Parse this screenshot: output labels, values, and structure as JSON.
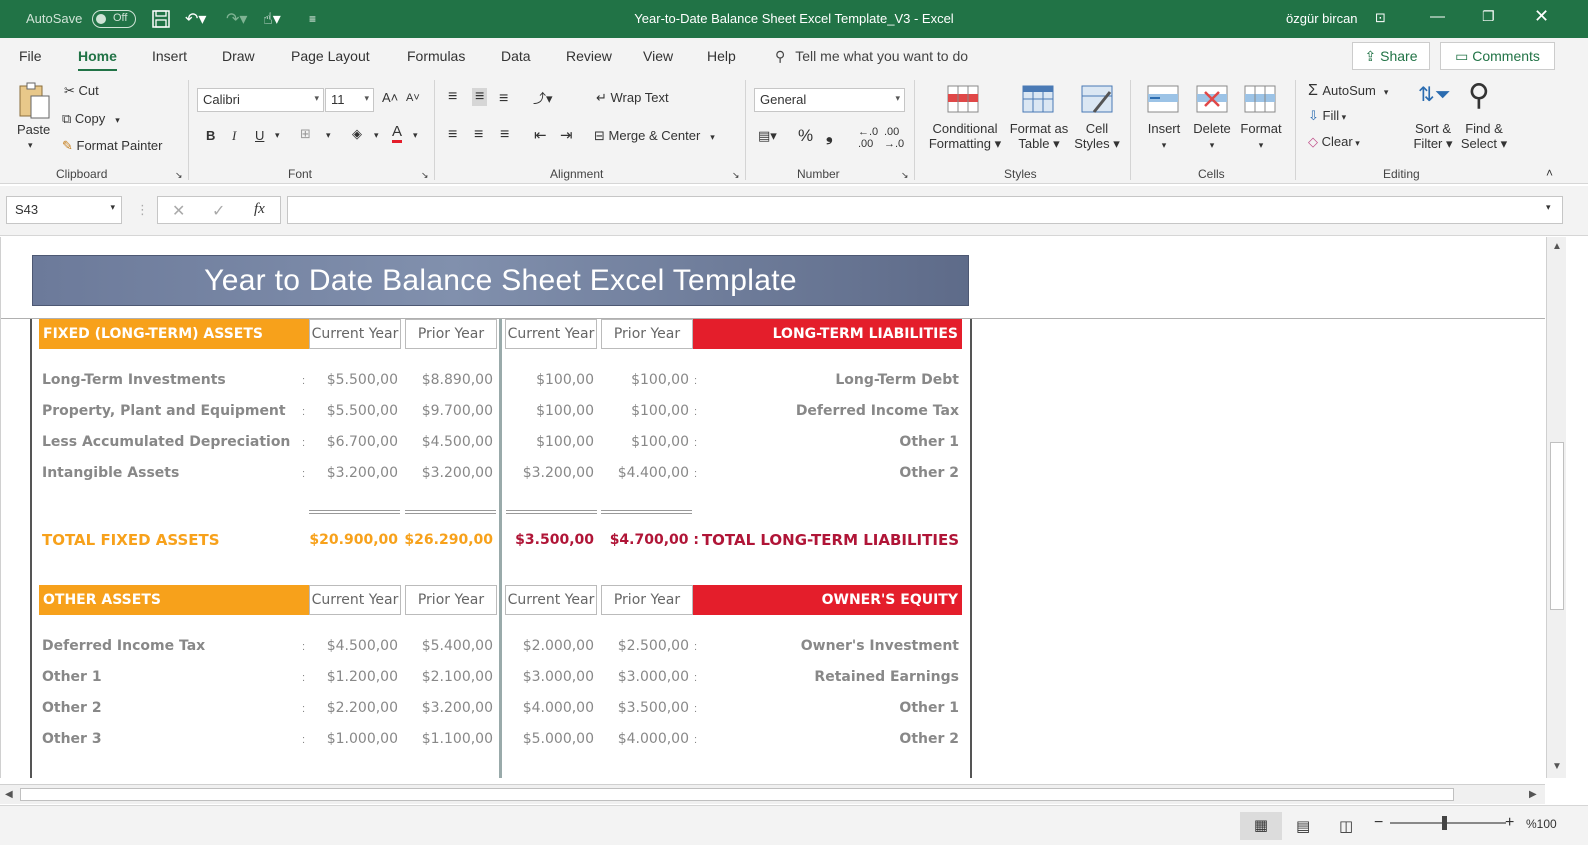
{
  "titlebar": {
    "autosave_label": "AutoSave",
    "autosave_state": "Off",
    "title": "Year-to-Date Balance Sheet Excel Template_V3  -  Excel",
    "user": "özgür bircan",
    "accent_color": "#217346"
  },
  "tabs": [
    "File",
    "Home",
    "Insert",
    "Draw",
    "Page Layout",
    "Formulas",
    "Data",
    "Review",
    "View",
    "Help"
  ],
  "active_tab": "Home",
  "tell_me": "Tell me what you want to do",
  "share_label": "Share",
  "comments_label": "Comments",
  "ribbon": {
    "clipboard": {
      "label": "Clipboard",
      "paste": "Paste",
      "cut": "Cut",
      "copy": "Copy",
      "format_painter": "Format Painter"
    },
    "font": {
      "label": "Font",
      "name": "Calibri",
      "size": "11",
      "bold": "B",
      "italic": "I",
      "underline": "U"
    },
    "alignment": {
      "label": "Alignment",
      "wrap_text": "Wrap Text",
      "merge_center": "Merge & Center"
    },
    "number": {
      "label": "Number",
      "format": "General"
    },
    "styles": {
      "label": "Styles",
      "conditional_1": "Conditional",
      "conditional_2": "Formatting",
      "format_table_1": "Format as",
      "format_table_2": "Table",
      "cell_styles_1": "Cell",
      "cell_styles_2": "Styles"
    },
    "cells": {
      "label": "Cells",
      "insert": "Insert",
      "delete": "Delete",
      "format": "Format"
    },
    "editing": {
      "label": "Editing",
      "autosum": "AutoSum",
      "fill": "Fill",
      "clear": "Clear",
      "sort_1": "Sort &",
      "sort_2": "Filter",
      "find_1": "Find &",
      "find_2": "Select"
    }
  },
  "formula_bar": {
    "name_box": "S43",
    "fx": "fx",
    "value": ""
  },
  "sheet": {
    "banner_title": "Year to Date Balance Sheet Excel Template",
    "col_current": "Current Year",
    "col_prior": "Prior Year",
    "fixed_assets": {
      "header": "FIXED (LONG-TERM) ASSETS",
      "rows": [
        {
          "label": "Long-Term Investments",
          "current": "$5.500,00",
          "prior": "$8.890,00"
        },
        {
          "label": "Property, Plant and Equipment",
          "current": "$5.500,00",
          "prior": "$9.700,00"
        },
        {
          "label": "Less Accumulated Depreciation",
          "current": "$6.700,00",
          "prior": "$4.500,00"
        },
        {
          "label": "Intangible Assets",
          "current": "$3.200,00",
          "prior": "$3.200,00"
        }
      ],
      "total_label": "TOTAL FIXED ASSETS",
      "total_current": "$20.900,00",
      "total_prior": "$26.290,00"
    },
    "long_term_liabilities": {
      "header": "LONG-TERM LIABILITIES",
      "rows": [
        {
          "label": "Long-Term Debt",
          "current": "$100,00",
          "prior": "$100,00"
        },
        {
          "label": "Deferred Income Tax",
          "current": "$100,00",
          "prior": "$100,00"
        },
        {
          "label": "Other 1",
          "current": "$100,00",
          "prior": "$100,00"
        },
        {
          "label": "Other 2",
          "current": "$3.200,00",
          "prior": "$4.400,00"
        }
      ],
      "total_label": "TOTAL LONG-TERM LIABILITIES",
      "total_current": "$3.500,00",
      "total_prior": "$4.700,00 :"
    },
    "other_assets": {
      "header": "OTHER ASSETS",
      "rows": [
        {
          "label": "Deferred Income Tax",
          "current": "$4.500,00",
          "prior": "$5.400,00"
        },
        {
          "label": "Other 1",
          "current": "$1.200,00",
          "prior": "$2.100,00"
        },
        {
          "label": "Other 2",
          "current": "$2.200,00",
          "prior": "$3.200,00"
        },
        {
          "label": "Other 3",
          "current": "$1.000,00",
          "prior": "$1.100,00"
        }
      ]
    },
    "owners_equity": {
      "header": "OWNER'S EQUITY",
      "rows": [
        {
          "label": "Owner's Investment",
          "current": "$2.000,00",
          "prior": "$2.500,00"
        },
        {
          "label": "Retained Earnings",
          "current": "$3.000,00",
          "prior": "$3.000,00"
        },
        {
          "label": "Other 1",
          "current": "$4.000,00",
          "prior": "$3.500,00"
        },
        {
          "label": "Other 2",
          "current": "$5.000,00",
          "prior": "$4.000,00"
        }
      ]
    },
    "colors": {
      "orange": "#f7a11b",
      "red": "#e41e2b",
      "total_red": "#b01537",
      "banner": "#6c7a9a"
    }
  },
  "status": {
    "zoom": "%100"
  }
}
